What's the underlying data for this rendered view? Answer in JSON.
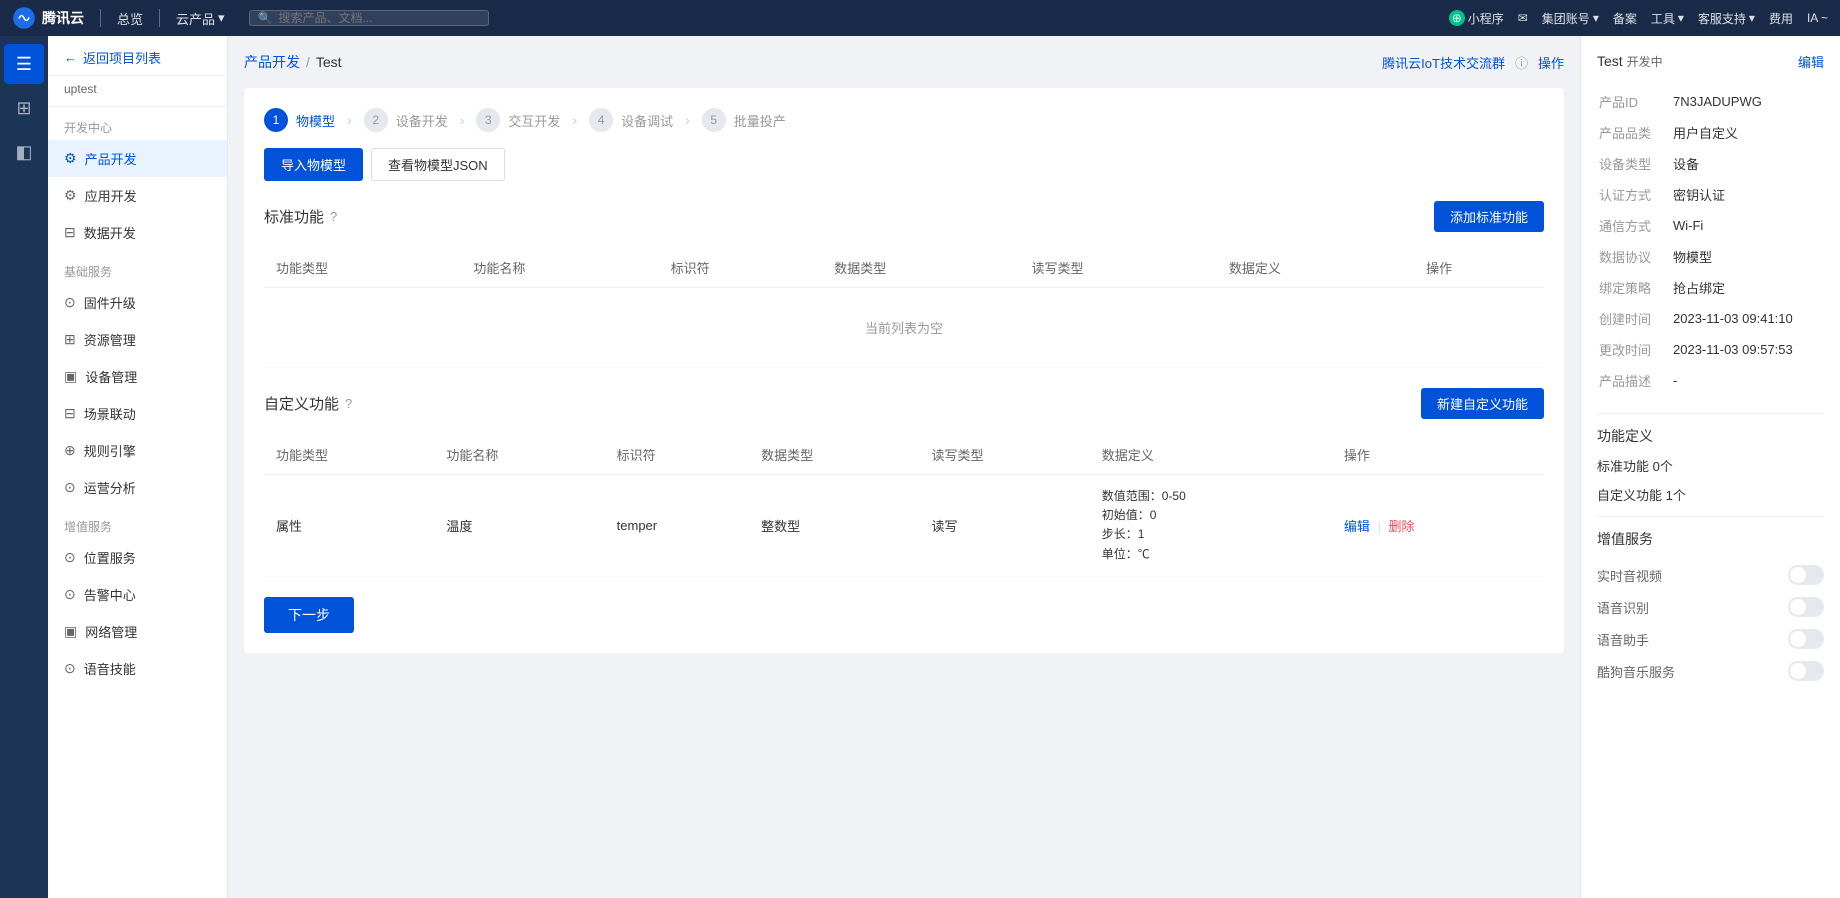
{
  "topNav": {
    "logo": "腾讯云",
    "nav_home": "总览",
    "nav_products": "云产品",
    "search_placeholder": "搜索产品、文档...",
    "mini_program": "小程序",
    "mail": "✉",
    "account": "集团账号",
    "account_arrow": "▾",
    "filing": "备案",
    "tools": "工具",
    "tools_arrow": "▾",
    "service": "客服支持",
    "service_arrow": "▾",
    "common": "费用",
    "user": "IA ~"
  },
  "iconSidebar": {
    "items": [
      {
        "icon": "☰",
        "name": "menu-icon"
      },
      {
        "icon": "⊞",
        "name": "grid-icon"
      },
      {
        "icon": "▣",
        "name": "square-icon"
      }
    ]
  },
  "leftSidebar": {
    "back_label": "返回项目列表",
    "project_name": "uptest",
    "dev_center": "开发中心",
    "product_dev": "产品开发",
    "app_dev": "应用开发",
    "data_dev": "数据开发",
    "basic_services": "基础服务",
    "firmware_upgrade": "固件升级",
    "resource_mgmt": "资源管理",
    "device_mgmt": "设备管理",
    "scene_linkage": "场景联动",
    "rule_engine": "规则引擎",
    "ops_analysis": "运营分析",
    "value_services": "增值服务",
    "location_service": "位置服务",
    "alarm_center": "告警中心",
    "network_mgmt": "网络管理",
    "voice_skill": "语音技能"
  },
  "breadcrumb": {
    "parent": "产品开发",
    "current": "Test",
    "link_text": "腾讯云IoT技术交流群"
  },
  "stepper": {
    "steps": [
      {
        "num": "1",
        "label": "物模型",
        "active": true
      },
      {
        "num": "2",
        "label": "设备开发",
        "active": false
      },
      {
        "num": "3",
        "label": "交互开发",
        "active": false
      },
      {
        "num": "4",
        "label": "设备调试",
        "active": false
      },
      {
        "num": "5",
        "label": "批量投产",
        "active": false
      }
    ]
  },
  "actionTabs": {
    "import_model": "导入物模型",
    "view_json": "查看物模型JSON"
  },
  "standardSection": {
    "title": "标准功能",
    "add_btn": "添加标准功能",
    "columns": [
      "功能类型",
      "功能名称",
      "标识符",
      "数据类型",
      "读写类型",
      "数据定义",
      "操作"
    ],
    "empty_text": "当前列表为空"
  },
  "customSection": {
    "title": "自定义功能",
    "add_btn": "新建自定义功能",
    "columns": [
      "功能类型",
      "功能名称",
      "标识符",
      "数据类型",
      "读写类型",
      "数据定义",
      "操作"
    ],
    "rows": [
      {
        "type": "属性",
        "name": "温度",
        "identifier": "temper",
        "dataType": "整数型",
        "rwType": "读写",
        "dataDef": "数值范围：0-50\n初始值：0\n步长：1\n单位：℃",
        "edit": "编辑",
        "delete": "删除"
      }
    ]
  },
  "nextBtn": "下一步",
  "rightPanel": {
    "title": "Test",
    "status": "开发中",
    "edit": "编辑",
    "product_id_label": "产品ID",
    "product_id_value": "7N3JADUPWG",
    "product_type_label": "产品品类",
    "product_type_value": "用户自定义",
    "device_type_label": "设备类型",
    "device_type_value": "设备",
    "auth_label": "认证方式",
    "auth_value": "密钥认证",
    "network_label": "通信方式",
    "network_value": "Wi-Fi",
    "protocol_label": "数据协议",
    "protocol_value": "物模型",
    "operation_label": "绑定策略",
    "operation_value": "抢占绑定",
    "created_label": "创建时间",
    "created_value": "2023-11-03 09:41:10",
    "updated_label": "更改时间",
    "updated_value": "2023-11-03 09:57:53",
    "desc_label": "产品描述",
    "desc_value": "-",
    "func_def_title": "功能定义",
    "std_func_label": "标准功能",
    "std_func_value": "0个",
    "custom_func_label": "自定义功能",
    "custom_func_value": "1个",
    "value_service_title": "增值服务",
    "realtime_video_label": "实时音视频",
    "voice_recog_label": "语音识别",
    "voice_assistant_label": "语音助手",
    "music_service_label": "酷狗音乐服务"
  }
}
